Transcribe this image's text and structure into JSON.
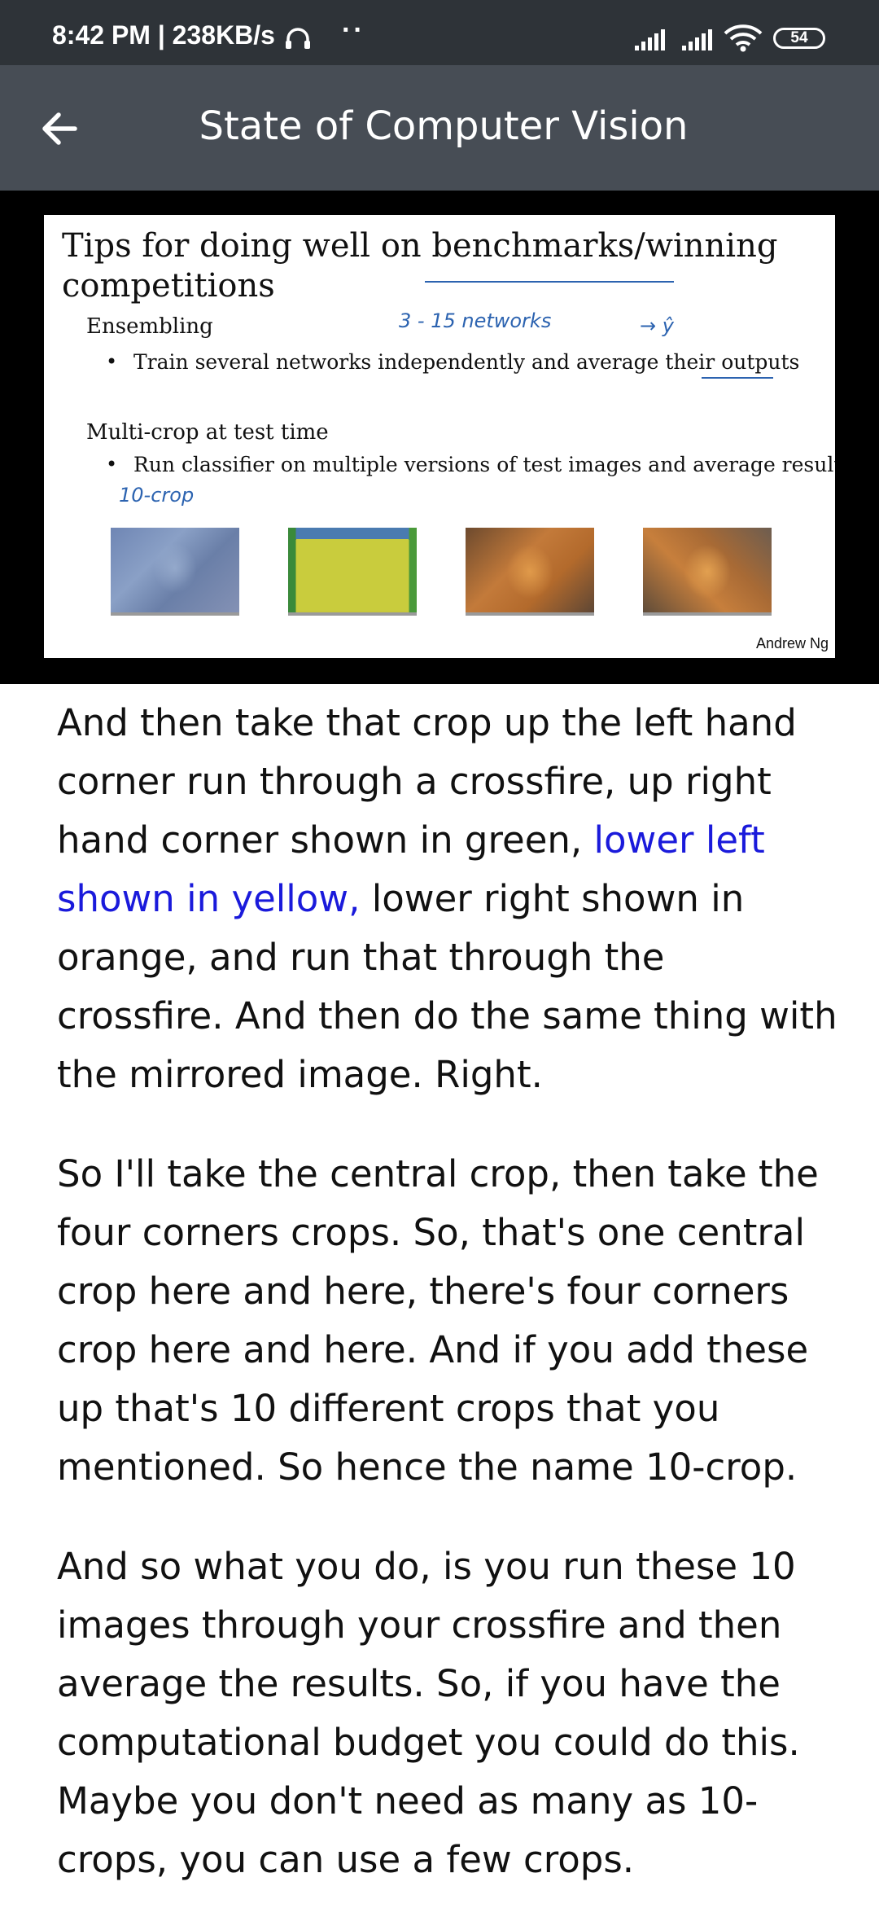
{
  "status_bar": {
    "time_speed": "8:42 PM | 238KB/s",
    "dots": "··",
    "battery": "54",
    "icons": [
      "headphones-icon",
      "signal-icon",
      "signal-icon",
      "wifi-icon",
      "battery-icon"
    ]
  },
  "app_bar": {
    "title": "State of Computer Vision",
    "back_icon": "arrow-left-icon"
  },
  "slide": {
    "title": "Tips for doing well on benchmarks/winning competitions",
    "section1": {
      "heading": "Ensembling",
      "bullet": "Train several networks independently and average their outputs",
      "note": "3 - 15  networks",
      "note2": "→ ŷ"
    },
    "section2": {
      "heading": "Multi-crop at test time",
      "bullet": "Run classifier on multiple versions of test images and average results",
      "note": "10-crop"
    },
    "credit": "Andrew Ng",
    "bullet_symbol": "•"
  },
  "transcript": {
    "p1_a": "And then take that crop up the left hand corner run through a crossfire, up right hand corner shown in green, ",
    "p1_highlight": "lower left shown in yellow,",
    "p1_b": " lower right shown in orange, and run that through the crossfire. And then do the same thing with the mirrored image. Right.",
    "p2": "So I'll take the central crop, then take the four corners crops. So, that's one central crop here and here, there's four corners crop here and here. And if you add these up that's 10 different crops that you mentioned. So hence the name 10-crop.",
    "p3": "And so what you do, is you run these 10 images through your crossfire and then average the results. So, if you have the computational budget you could do this. Maybe you don't need as many as 10-crops, you can use a few crops."
  },
  "colors": {
    "status_bar_bg": "#2e3338",
    "app_bar_bg": "#474d55",
    "highlight_text": "#1a1adb",
    "annotation_ink": "#2c63b0"
  }
}
